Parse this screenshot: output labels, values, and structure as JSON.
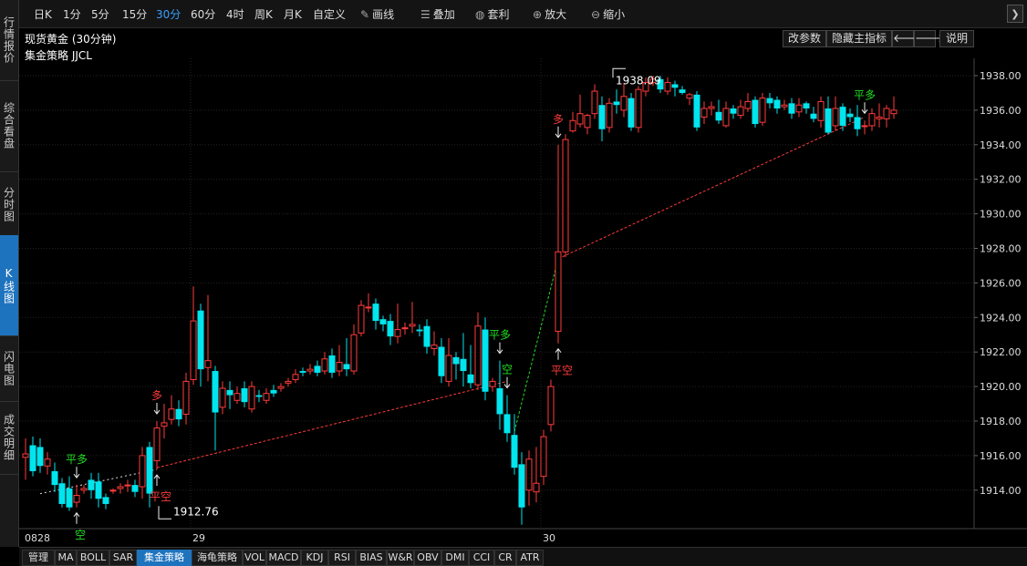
{
  "sidebar": {
    "tabs": [
      {
        "label": "行情报价",
        "active": false
      },
      {
        "label": "综合看盘",
        "active": false
      },
      {
        "label": "分时图",
        "active": false
      },
      {
        "label": "K线图",
        "active": true
      },
      {
        "label": "闪电图",
        "active": false
      },
      {
        "label": "成交明细",
        "active": false
      }
    ]
  },
  "toolbar": {
    "periods": [
      "日K",
      "1分",
      "5分",
      "15分",
      "30分",
      "60分",
      "4时",
      "周K",
      "月K",
      "自定义"
    ],
    "active_period": "30分",
    "tools": [
      {
        "label": "画线",
        "icon": "pencil-icon"
      },
      {
        "label": "叠加",
        "icon": "stack-icon"
      },
      {
        "label": "套利",
        "icon": "money-bag-icon"
      },
      {
        "label": "放大",
        "icon": "zoom-in-icon"
      },
      {
        "label": "缩小",
        "icon": "zoom-out-icon"
      }
    ]
  },
  "header": {
    "title": "现货黄金 (30分钟)",
    "strategy_label": "集金策略 JJCL",
    "buttons": [
      "改参数",
      "隐藏主指标"
    ],
    "help": "说明"
  },
  "bottom_bar": {
    "items": [
      "管理",
      "MA",
      "BOLL",
      "SAR",
      "集金策略",
      "海龟策略",
      "VOL",
      "MACD",
      "KDJ",
      "RSI",
      "BIAS",
      "W&R",
      "OBV",
      "DMI",
      "CCI",
      "CR",
      "ATR"
    ],
    "active": "集金策略"
  },
  "colors": {
    "up": "#ff3b3b",
    "down": "#00e5ee",
    "buy": "#ff3b3b",
    "sell": "#22dd22",
    "accent": "#1e73be"
  },
  "chart_data": {
    "type": "candlestick",
    "symbol": "现货黄金",
    "period": "30分钟",
    "ylim": [
      1912,
      1939.5
    ],
    "yticks": [
      1914,
      1916,
      1918,
      1920,
      1922,
      1924,
      1926,
      1928,
      1930,
      1932,
      1934,
      1936,
      1938
    ],
    "ytick_labels": [
      "1914.00",
      "1916.00",
      "1918.00",
      "1920.00",
      "1922.00",
      "1924.00",
      "1926.00",
      "1928.00",
      "1930.00",
      "1932.00",
      "1934.00",
      "1936.00",
      "1938.00"
    ],
    "x_labels": [
      {
        "index": 0,
        "label": "0828"
      },
      {
        "index": 23,
        "label": "29"
      },
      {
        "index": 71,
        "label": "30"
      }
    ],
    "grid": true,
    "candles": [
      [
        1915.9,
        1916.1,
        1914.6,
        1917.0
      ],
      [
        1916.6,
        1915.1,
        1914.8,
        1917.1
      ],
      [
        1916.5,
        1915.4,
        1915.0,
        1917.0
      ],
      [
        1915.4,
        1915.8,
        1914.9,
        1916.2
      ],
      [
        1915.1,
        1914.3,
        1913.9,
        1915.6
      ],
      [
        1914.4,
        1913.2,
        1913.0,
        1914.7
      ],
      [
        1914.1,
        1913.0,
        1912.8,
        1914.8
      ],
      [
        1913.3,
        1913.7,
        1913.0,
        1914.3
      ],
      [
        1914.0,
        1914.1,
        1913.8,
        1914.3
      ],
      [
        1914.6,
        1914.0,
        1913.5,
        1915.0
      ],
      [
        1914.5,
        1913.5,
        1913.0,
        1915.0
      ],
      [
        1913.6,
        1913.2,
        1912.9,
        1913.8
      ],
      [
        1914.0,
        1914.0,
        1913.8,
        1914.1
      ],
      [
        1914.1,
        1914.2,
        1913.8,
        1914.4
      ],
      [
        1914.3,
        1914.3,
        1913.9,
        1914.6
      ],
      [
        1914.3,
        1913.9,
        1913.6,
        1914.6
      ],
      [
        1914.2,
        1916.0,
        1913.5,
        1916.5
      ],
      [
        1916.5,
        1913.8,
        1913.0,
        1916.8
      ],
      [
        1915.7,
        1917.6,
        1915.2,
        1918.0
      ],
      [
        1917.7,
        1917.9,
        1917.0,
        1919.0
      ],
      [
        1918.1,
        1918.7,
        1917.8,
        1919.5
      ],
      [
        1918.7,
        1918.1,
        1917.7,
        1919.2
      ],
      [
        1918.4,
        1920.3,
        1917.8,
        1920.8
      ],
      [
        1920.4,
        1923.8,
        1920.1,
        1925.8
      ],
      [
        1924.4,
        1921.0,
        1920.0,
        1924.8
      ],
      [
        1921.1,
        1921.5,
        1920.3,
        1925.3
      ],
      [
        1920.9,
        1918.5,
        1916.3,
        1921.2
      ],
      [
        1918.8,
        1919.9,
        1918.4,
        1920.3
      ],
      [
        1919.8,
        1919.5,
        1918.7,
        1920.3
      ],
      [
        1919.2,
        1919.6,
        1919.0,
        1920.0
      ],
      [
        1919.9,
        1919.1,
        1918.8,
        1920.3
      ],
      [
        1918.7,
        1920.0,
        1918.5,
        1920.3
      ],
      [
        1919.5,
        1919.4,
        1919.1,
        1919.8
      ],
      [
        1919.2,
        1919.6,
        1919.0,
        1919.9
      ],
      [
        1919.8,
        1919.6,
        1919.4,
        1920.1
      ],
      [
        1919.9,
        1920.0,
        1919.7,
        1920.2
      ],
      [
        1920.2,
        1920.3,
        1920.0,
        1920.5
      ],
      [
        1920.4,
        1920.7,
        1920.2,
        1921.0
      ],
      [
        1920.9,
        1920.8,
        1920.6,
        1921.1
      ],
      [
        1920.9,
        1921.0,
        1920.7,
        1921.3
      ],
      [
        1921.2,
        1920.8,
        1920.6,
        1921.5
      ],
      [
        1920.9,
        1921.6,
        1920.7,
        1922.0
      ],
      [
        1921.8,
        1920.8,
        1920.5,
        1922.2
      ],
      [
        1920.9,
        1921.4,
        1920.6,
        1922.4
      ],
      [
        1921.3,
        1921.0,
        1920.6,
        1922.8
      ],
      [
        1920.9,
        1923.0,
        1920.7,
        1923.6
      ],
      [
        1923.1,
        1924.7,
        1922.9,
        1925.0
      ],
      [
        1924.6,
        1924.6,
        1924.3,
        1925.4
      ],
      [
        1924.8,
        1923.8,
        1923.3,
        1925.1
      ],
      [
        1923.9,
        1923.6,
        1923.2,
        1924.1
      ],
      [
        1923.8,
        1922.9,
        1922.4,
        1924.2
      ],
      [
        1922.9,
        1923.3,
        1922.5,
        1924.8
      ],
      [
        1923.4,
        1923.4,
        1923.0,
        1923.7
      ],
      [
        1923.5,
        1923.6,
        1923.1,
        1924.9
      ],
      [
        1923.3,
        1923.2,
        1922.9,
        1923.6
      ],
      [
        1923.5,
        1922.3,
        1921.9,
        1923.9
      ],
      [
        1922.2,
        1922.4,
        1921.8,
        1923.2
      ],
      [
        1922.3,
        1920.6,
        1920.2,
        1922.8
      ],
      [
        1920.3,
        1921.8,
        1920.0,
        1922.8
      ],
      [
        1921.7,
        1921.3,
        1920.4,
        1922.0
      ],
      [
        1921.6,
        1920.9,
        1920.0,
        1923.1
      ],
      [
        1920.7,
        1920.2,
        1919.9,
        1922.4
      ],
      [
        1920.1,
        1923.5,
        1919.8,
        1924.3
      ],
      [
        1923.3,
        1919.7,
        1919.2,
        1924.0
      ],
      [
        1920.0,
        1920.3,
        1919.7,
        1920.5
      ],
      [
        1919.9,
        1918.4,
        1917.5,
        1921.5
      ],
      [
        1918.4,
        1917.3,
        1916.8,
        1919.5
      ],
      [
        1917.2,
        1915.3,
        1914.9,
        1918.4
      ],
      [
        1915.5,
        1913.0,
        1912.0,
        1916.2
      ],
      [
        1914.0,
        1915.8,
        1913.1,
        1916.3
      ],
      [
        1913.9,
        1914.4,
        1913.3,
        1916.5
      ],
      [
        1914.8,
        1917.1,
        1914.3,
        1917.5
      ],
      [
        1917.8,
        1920.0,
        1917.4,
        1920.4
      ],
      [
        1923.2,
        1927.8,
        1922.5,
        1934.0
      ],
      [
        1927.8,
        1934.3,
        1927.5,
        1934.6
      ],
      [
        1934.8,
        1935.4,
        1934.7,
        1935.9
      ],
      [
        1935.2,
        1935.8,
        1935.0,
        1936.9
      ],
      [
        1935.0,
        1935.7,
        1934.6,
        1935.8
      ],
      [
        1935.8,
        1937.1,
        1935.5,
        1937.5
      ],
      [
        1936.3,
        1934.9,
        1934.2,
        1936.8
      ],
      [
        1935.0,
        1936.4,
        1934.7,
        1936.7
      ],
      [
        1936.5,
        1936.3,
        1935.8,
        1937.2
      ],
      [
        1936.0,
        1936.8,
        1935.6,
        1937.6
      ],
      [
        1936.7,
        1935.0,
        1934.8,
        1937.0
      ],
      [
        1935.0,
        1937.2,
        1934.7,
        1937.4
      ],
      [
        1937.1,
        1937.6,
        1936.8,
        1937.9
      ],
      [
        1937.6,
        1937.8,
        1937.4,
        1938.0
      ],
      [
        1937.8,
        1937.2,
        1937.0,
        1938.0
      ],
      [
        1937.1,
        1937.6,
        1936.9,
        1937.9
      ],
      [
        1937.5,
        1937.3,
        1936.8,
        1937.7
      ],
      [
        1937.2,
        1937.0,
        1936.9,
        1937.4
      ],
      [
        1936.7,
        1936.9,
        1936.3,
        1937.0
      ],
      [
        1936.9,
        1935.0,
        1934.8,
        1937.1
      ],
      [
        1935.6,
        1936.1,
        1935.2,
        1936.5
      ],
      [
        1936.1,
        1936.2,
        1935.7,
        1936.5
      ],
      [
        1935.9,
        1935.4,
        1935.2,
        1936.6
      ],
      [
        1935.1,
        1936.1,
        1935.0,
        1936.5
      ],
      [
        1936.1,
        1935.8,
        1935.5,
        1936.3
      ],
      [
        1935.7,
        1936.2,
        1935.5,
        1936.6
      ],
      [
        1936.1,
        1936.5,
        1935.9,
        1937.0
      ],
      [
        1936.6,
        1935.2,
        1935.0,
        1936.8
      ],
      [
        1935.3,
        1936.7,
        1935.1,
        1937.0
      ],
      [
        1936.7,
        1936.4,
        1936.1,
        1937.0
      ],
      [
        1936.6,
        1936.1,
        1935.8,
        1936.8
      ],
      [
        1936.2,
        1936.3,
        1936.0,
        1936.6
      ],
      [
        1936.4,
        1935.8,
        1935.5,
        1936.7
      ],
      [
        1935.9,
        1936.3,
        1935.6,
        1936.7
      ],
      [
        1936.4,
        1936.1,
        1935.8,
        1936.5
      ],
      [
        1935.8,
        1935.5,
        1935.3,
        1936.2
      ],
      [
        1935.4,
        1936.5,
        1935.0,
        1936.8
      ],
      [
        1936.1,
        1934.7,
        1934.6,
        1936.8
      ],
      [
        1935.1,
        1936.1,
        1934.8,
        1936.8
      ],
      [
        1936.2,
        1935.1,
        1934.8,
        1936.4
      ],
      [
        1935.8,
        1935.6,
        1935.3,
        1936.1
      ],
      [
        1935.6,
        1934.9,
        1934.5,
        1936.3
      ],
      [
        1935.1,
        1935.1,
        1934.6,
        1935.4
      ],
      [
        1935.1,
        1935.8,
        1934.8,
        1936.1
      ],
      [
        1935.5,
        1935.6,
        1935.0,
        1936.4
      ],
      [
        1935.5,
        1936.1,
        1935.0,
        1936.3
      ],
      [
        1935.8,
        1936.0,
        1935.5,
        1936.8
      ]
    ],
    "ma_line": [
      [
        2,
        1913.8
      ],
      [
        18,
        1915.2
      ]
    ],
    "trend_lines": [
      {
        "from": [
          18,
          1915.3
        ],
        "to": [
          66,
          1920.3
        ],
        "color": "#ff3b3b"
      },
      {
        "from": [
          67,
          1917.4
        ],
        "to": [
          73,
          1927.4
        ],
        "color": "#22dd22"
      },
      {
        "from": [
          73,
          1927.4
        ],
        "to": [
          115,
          1935.6
        ],
        "color": "#ff3b3b"
      }
    ],
    "signals": [
      {
        "index": 7,
        "label": "平多",
        "position": "above",
        "color": "#22dd22"
      },
      {
        "index": 7,
        "label": "空",
        "position": "below",
        "color": "#22dd22"
      },
      {
        "index": 18,
        "label": "多",
        "position": "above",
        "color": "#ff3b3b"
      },
      {
        "index": 18,
        "label": "平空",
        "position": "below",
        "color": "#ff3b3b"
      },
      {
        "index": 65,
        "label": "平多",
        "position": "above",
        "color": "#22dd22"
      },
      {
        "index": 66,
        "label": "空",
        "position": "above",
        "color": "#22dd22"
      },
      {
        "index": 73,
        "label": "多",
        "position": "above",
        "color": "#ff3b3b"
      },
      {
        "index": 73,
        "label": "平空",
        "position": "below",
        "color": "#ff3b3b"
      },
      {
        "index": 115,
        "label": "平多",
        "position": "above",
        "color": "#22dd22"
      }
    ],
    "annotations": [
      {
        "label": "1912.76",
        "index": 18,
        "value": 1912.76
      },
      {
        "label": "1938.09",
        "index": 83,
        "value": 1938.09
      }
    ]
  }
}
